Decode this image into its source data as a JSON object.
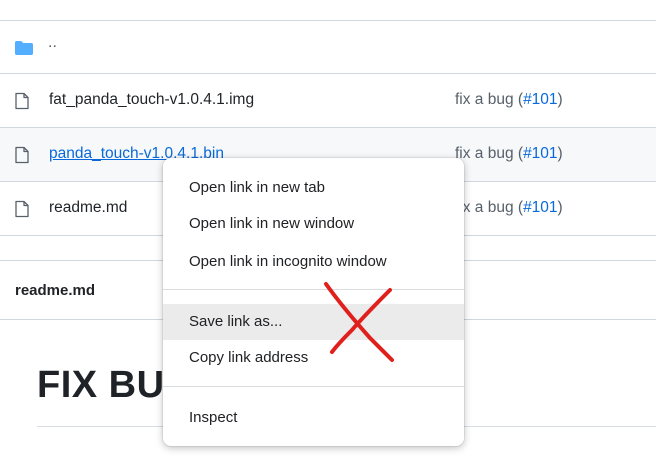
{
  "file_list": {
    "parent_dir": "..",
    "rows": [
      {
        "name": "fat_panda_touch-v1.0.4.1.img",
        "commit_text": "fix a bug (",
        "issue": "#101",
        "commit_close": ")"
      },
      {
        "name": "panda_touch-v1.0.4.1.bin",
        "commit_text": "fix a bug (",
        "issue": "#101",
        "commit_close": ")"
      },
      {
        "name": "readme.md",
        "commit_text": "fix a bug (",
        "issue": "#101",
        "commit_close": ")"
      }
    ]
  },
  "readme": {
    "title": "readme.md",
    "heading": "FIX BU"
  },
  "context_menu": {
    "items": [
      {
        "label": "Open link in new tab"
      },
      {
        "label": "Open link in new window"
      },
      {
        "label": "Open link in incognito window"
      },
      {
        "label": "Save link as..."
      },
      {
        "label": "Copy link address"
      },
      {
        "label": "Inspect"
      }
    ]
  },
  "colors": {
    "link": "#0969da",
    "folder": "#54aeff",
    "annotation": "#e0201c"
  }
}
